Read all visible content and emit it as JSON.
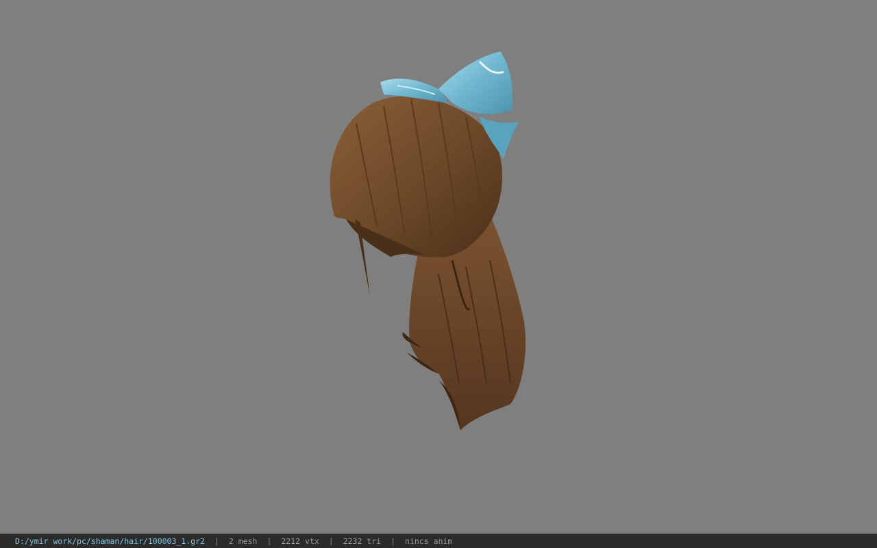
{
  "viewer": {
    "background_color": "#7f7f7f",
    "model_icon": "hair-ponytail-with-bow-model",
    "hair_color": "#6e4a2a",
    "bow_color": "#6fb6cf"
  },
  "status_bar": {
    "file_path": "D:/ymir work/pc/shaman/hair/100003_1.gr2",
    "separator": "|",
    "mesh_count": "2 mesh",
    "vertex_count": "2212 vtx",
    "triangle_count": "2232 tri",
    "anim_label": "nincs anim"
  }
}
